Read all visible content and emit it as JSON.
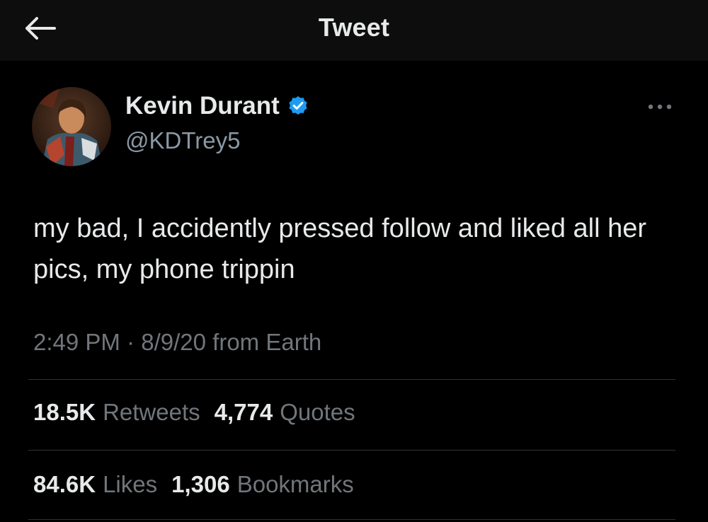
{
  "header": {
    "title": "Tweet",
    "back_icon": "arrow-left-icon"
  },
  "author": {
    "name": "Kevin Durant",
    "handle": "@KDTrey5",
    "verified": true,
    "verified_color": "#1d9bf0",
    "avatar": "avatar-image"
  },
  "tweet": {
    "text": "my bad, I accidently pressed follow and liked all her pics, my phone trippin",
    "time": "2:49 PM",
    "separator": "·",
    "date": "8/9/20",
    "source": "from Earth"
  },
  "stats": {
    "retweets_count": "18.5K",
    "retweets_label": "Retweets",
    "quotes_count": "4,774",
    "quotes_label": "Quotes",
    "likes_count": "84.6K",
    "likes_label": "Likes",
    "bookmarks_count": "1,306",
    "bookmarks_label": "Bookmarks"
  },
  "colors": {
    "background": "#000000",
    "topbar": "#0d0d0d",
    "text_primary": "#e7e9ea",
    "text_secondary": "#71767b",
    "divider": "#2f3336"
  }
}
